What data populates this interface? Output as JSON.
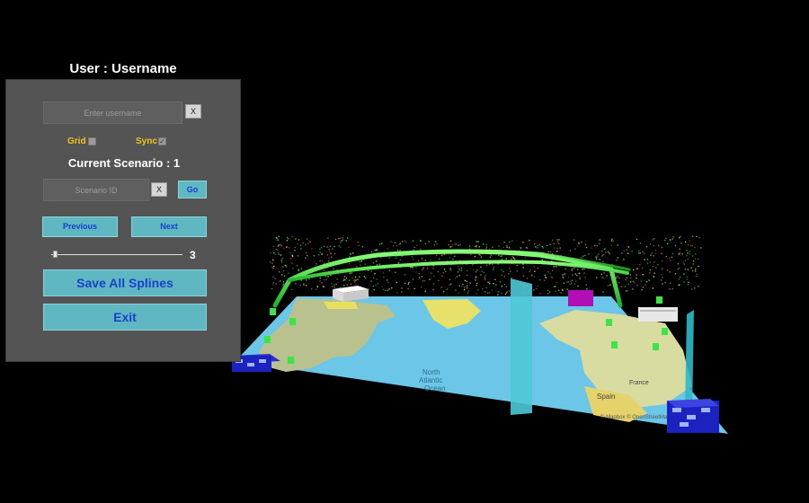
{
  "user": {
    "label": "User :",
    "name": "Username"
  },
  "username_input": {
    "placeholder": "Enter username",
    "value": ""
  },
  "clear_label": "X",
  "toggles": {
    "grid": {
      "label": "Grid",
      "checked": false
    },
    "sync": {
      "label": "Sync",
      "checked": true
    }
  },
  "scenario": {
    "label": "Current Scenario :",
    "value": "1"
  },
  "scenario_input": {
    "placeholder": "Scenario ID",
    "value": ""
  },
  "go_label": "Go",
  "nav": {
    "previous": "Previous",
    "next": "Next"
  },
  "slider": {
    "value": "3"
  },
  "actions": {
    "save": "Save All Splines",
    "exit": "Exit"
  },
  "map": {
    "ocean_label_1": "North",
    "ocean_label_2": "Atlantic",
    "ocean_label_3": "Ocean",
    "country_1": "Spain",
    "country_2": "France",
    "attribution": "© Mapbox © OpenStreetMap"
  },
  "colors": {
    "panel_bg": "#545454",
    "button_bg": "#5fb7c2",
    "button_text": "#1a3fcc",
    "toggle_label": "#f0c419",
    "spline": "#3ee84a",
    "water_column": "#4fc8d6"
  }
}
